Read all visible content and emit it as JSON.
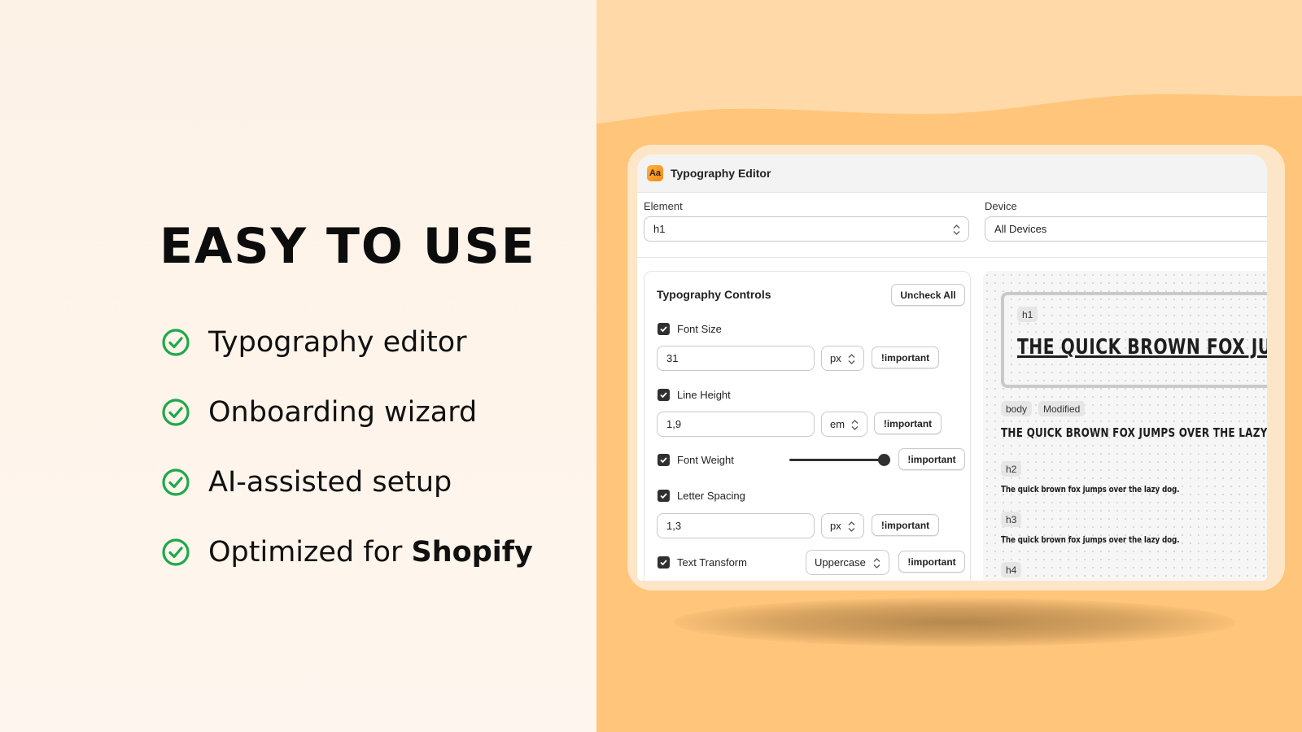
{
  "headline": "EASY TO USE",
  "features": [
    {
      "text": "Typography editor"
    },
    {
      "text": "Onboarding wizard"
    },
    {
      "text": "AI-assisted setup"
    },
    {
      "text": "Optimized for ",
      "bold": "Shopify"
    }
  ],
  "colors": {
    "check": "#1ea84a",
    "accent": "#ffc57a"
  },
  "app": {
    "icon_text": "Aa",
    "title": "Typography Editor",
    "element": {
      "label": "Element",
      "value": "h1"
    },
    "device": {
      "label": "Device",
      "value": "All Devices"
    },
    "controls": {
      "title": "Typography Controls",
      "uncheck_all": "Uncheck All",
      "font_size": {
        "label": "Font Size",
        "value": "31",
        "unit": "px",
        "important": "!important"
      },
      "line_height": {
        "label": "Line Height",
        "value": "1,9",
        "unit": "em",
        "important": "!important"
      },
      "font_weight": {
        "label": "Font Weight",
        "slider_level": 1.0,
        "important": "!important"
      },
      "letter_spacing": {
        "label": "Letter Spacing",
        "value": "1,3",
        "unit": "px",
        "important": "!important"
      },
      "text_transform": {
        "label": "Text Transform",
        "value": "Uppercase",
        "important": "!important"
      }
    },
    "preview": {
      "h1_tag": "h1",
      "h1_text": "THE QUICK BROWN FOX JU",
      "body_tag": "body",
      "modified_tag": "Modified",
      "body_text": "THE QUICK BROWN FOX JUMPS OVER THE LAZY D",
      "h2_tag": "h2",
      "h2_text": "The quick brown fox jumps over the lazy dog.",
      "h3_tag": "h3",
      "h3_text": "The quick brown fox jumps over the lazy dog.",
      "h4_tag": "h4"
    }
  }
}
